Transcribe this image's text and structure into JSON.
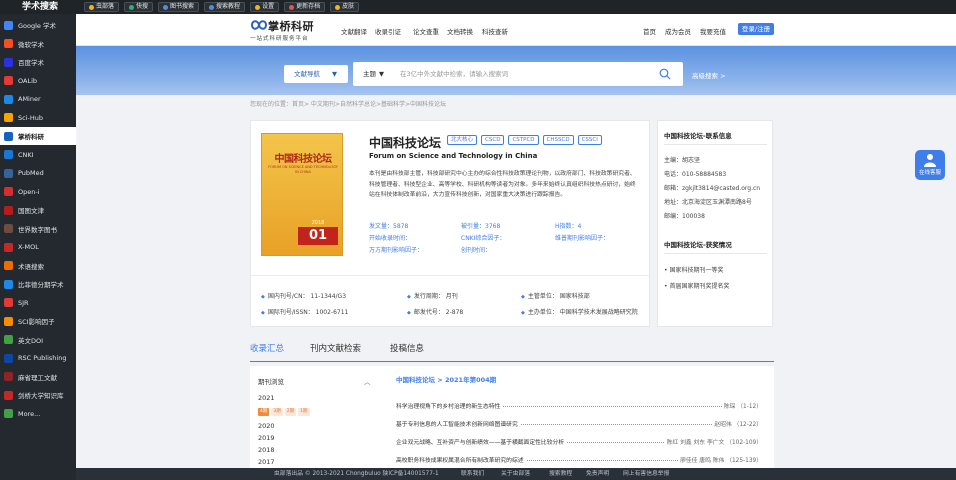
{
  "topbar": {
    "brand": "学术搜索",
    "buttons": [
      {
        "label": "虫部落",
        "color": "#f6b221"
      },
      {
        "label": "快搜",
        "color": "#2fb16b"
      },
      {
        "label": "图书搜索",
        "color": "#4a90e2"
      },
      {
        "label": "搜索教程",
        "color": "#4a90e2"
      },
      {
        "label": "设置",
        "color": "#f6b221"
      },
      {
        "label": "更新存档",
        "color": "#e05656"
      },
      {
        "label": "皮肤",
        "color": "#f6b221"
      }
    ]
  },
  "sidebar": {
    "items": [
      {
        "label": "Google 学术",
        "color": "#4285f4",
        "active": false
      },
      {
        "label": "微软学术",
        "color": "#f25022",
        "active": false
      },
      {
        "label": "百度学术",
        "color": "#2932e1",
        "active": false
      },
      {
        "label": "OALib",
        "color": "#e53935",
        "active": false
      },
      {
        "label": "AMiner",
        "color": "#1e88e5",
        "active": false
      },
      {
        "label": "Sci-Hub",
        "color": "#f4a300",
        "active": false
      },
      {
        "label": "掌桥科研",
        "color": "#1565c0",
        "active": true
      },
      {
        "label": "CNKI",
        "color": "#1976d2",
        "active": false
      },
      {
        "label": "PubMed",
        "color": "#326599",
        "active": false
      },
      {
        "label": "Open-i",
        "color": "#d32f2f",
        "active": false
      },
      {
        "label": "国图文津",
        "color": "#b71c1c",
        "active": false
      },
      {
        "label": "世界数字图书",
        "color": "#6d4c41",
        "active": false
      },
      {
        "label": "X-MOL",
        "color": "#c62828",
        "active": false
      },
      {
        "label": "术语搜索",
        "color": "#ef6c00",
        "active": false
      },
      {
        "label": "比菲德分期学术",
        "color": "#1e88e5",
        "active": false
      },
      {
        "label": "SJR",
        "color": "#e53935",
        "active": false
      },
      {
        "label": "SCI影响因子",
        "color": "#fb8c00",
        "active": false
      },
      {
        "label": "英文DOI",
        "color": "#43a047",
        "active": false
      },
      {
        "label": "RSC Publishing",
        "color": "#0d47a1",
        "active": false
      },
      {
        "label": "麻省理工文献",
        "color": "#8e2424",
        "active": false
      },
      {
        "label": "剑桥大学知识库",
        "color": "#c62828",
        "active": false
      },
      {
        "label": "More...",
        "color": "#43a047",
        "active": false
      }
    ]
  },
  "header": {
    "logo_title": "掌桥科研",
    "logo_sub": "一站式科研服务平台",
    "nav": [
      "文献翻译",
      "收录引证",
      "论文查重",
      "文档转换",
      "科技查新"
    ],
    "right_links": [
      "首页",
      "成为会员",
      "我要充值"
    ],
    "login": "登录/注册"
  },
  "hero": {
    "scope": "文献导航",
    "field": "主题",
    "placeholder": "在3亿中外文献中检索，请输入搜索词",
    "advanced": "高级搜索 >"
  },
  "breadcrumb": "您现在的位置：首页> 中文期刊>自然科学总论>基础科学>中国科技论坛",
  "journal": {
    "cover_title": "中国科技论坛",
    "cover_en": "FORUM ON SCIENCE AND TECHNOLOGY IN CHINA",
    "cover_year": "2018",
    "cover_issue": "01",
    "title": "中国科技论坛",
    "tags": [
      "北大核心",
      "CSCD",
      "CSTPCD",
      "CHSSCD",
      "CSSCI"
    ],
    "title_en": "Forum on Science and Technology in China",
    "description": "本刊是由科技部主管，科技部研究中心主办的综合性科技政策理论刊物，以政府部门、科技政策研究者、科技管理者、科技型企业、高等学校、科研机构等读者为对象。多年来始终认真组织科技热点研讨，始终站在科技体制改革前沿，大力宣传科技创新，对国家重大决策进行跟踪报告。",
    "stats": [
      {
        "label": "发文量：",
        "value": "5878"
      },
      {
        "label": "被引量：",
        "value": "3768"
      },
      {
        "label": "H指数：",
        "value": "4"
      },
      {
        "label": "开始收录时间：",
        "value": ""
      },
      {
        "label": "CNKI综合因子：",
        "value": ""
      },
      {
        "label": "维普期刊影响因子：",
        "value": ""
      },
      {
        "label": "万方期刊影响因子：",
        "value": ""
      },
      {
        "label": "创刊时间：",
        "value": ""
      }
    ],
    "meta": [
      "国内刊号/CN：  11-1344/G3",
      "发行周期：  月刊",
      "主管单位：  国家科技部",
      "国际刊号/ISSN：  1002-6711",
      "邮发代号：  2-878",
      "主办单位：  中国科学技术发展战略研究院"
    ]
  },
  "contact": {
    "title": "中国科技论坛-联系信息",
    "lines": [
      "主编：胡志坚",
      "电话：010-58884583",
      "邮箱：zgkjlt3814@casted.org.cn",
      "地址：北京海淀区玉渊潭南路8号",
      "邮编：100038"
    ],
    "award_title": "中国科技论坛-获奖情况",
    "awards": [
      "• 国家科技期刊一等奖",
      "• 首届国家期刊奖提名奖"
    ]
  },
  "tabs": [
    "收录汇总",
    "刊内文献检索",
    "投稿信息"
  ],
  "catalog": {
    "header": "期刊浏览",
    "years": [
      "2021",
      "2020",
      "2019",
      "2018",
      "2017"
    ],
    "issues": [
      "4期",
      "3期",
      "2期",
      "1期"
    ],
    "current": "中国科技论坛 > 2021年第004期",
    "articles": [
      {
        "title": "科学治理视角下的乡村治理的新生态特性",
        "authors": "陈琛 （1-12）"
      },
      {
        "title": "基于专利信息的人工智能技术创新网络图谱研究",
        "authors": "赵昭伟 （12-22）"
      },
      {
        "title": "企业双元战略、互补资产与创新绩效——基于横截面定性比较分析",
        "authors": "陈红 刘鑫 刘东 李广文 （102-109）"
      },
      {
        "title": "高校职务科技成果权属混合所有制改革研究的综述",
        "authors": "廖佳佳 唐鸣 陈伟 （125-139）"
      }
    ]
  },
  "footer": [
    "虫部落出品  © 2013-2021 Chongbuluo  陕ICP备14001577-1",
    "联系我们",
    "关于虫部落",
    "搜索教程",
    "免责声明",
    "网上有害信息举报"
  ],
  "float_button": "在线客服",
  "colors": {
    "accent": "#3f7ee8",
    "sidebar_bg": "#23292e",
    "tag_orange": "#f08a3c"
  }
}
